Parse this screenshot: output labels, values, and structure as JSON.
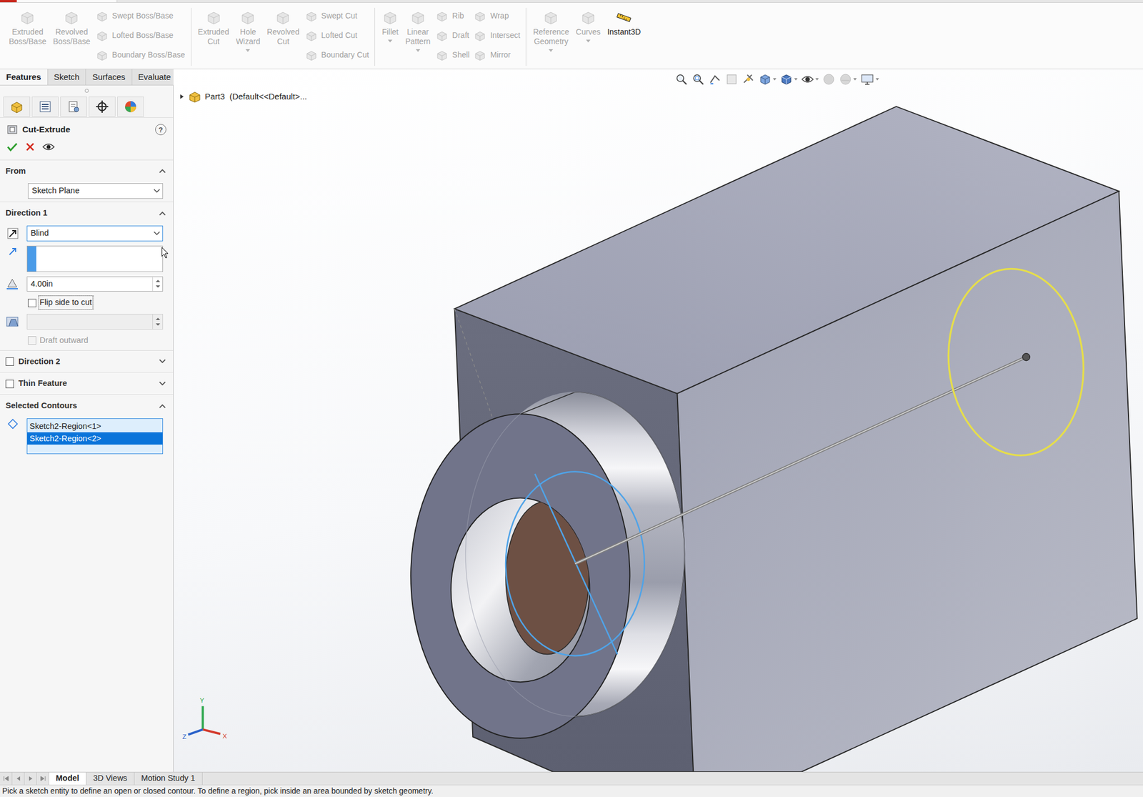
{
  "ribbon": {
    "groups": [
      {
        "items": [
          {
            "kind": "large",
            "label": "Extruded Boss/Base",
            "disabled": true,
            "menu": false
          },
          {
            "kind": "large",
            "label": "Revolved Boss/Base",
            "disabled": true,
            "menu": false
          },
          {
            "kind": "stack",
            "items": [
              {
                "label": "Swept Boss/Base",
                "disabled": true
              },
              {
                "label": "Lofted Boss/Base",
                "disabled": true
              },
              {
                "label": "Boundary Boss/Base",
                "disabled": true
              }
            ]
          }
        ]
      },
      {
        "items": [
          {
            "kind": "large",
            "label": "Extruded Cut",
            "disabled": true,
            "menu": false
          },
          {
            "kind": "large",
            "label": "Hole Wizard",
            "disabled": true,
            "menu": true
          },
          {
            "kind": "large",
            "label": "Revolved Cut",
            "disabled": true,
            "menu": false
          },
          {
            "kind": "stack",
            "items": [
              {
                "label": "Swept Cut",
                "disabled": true
              },
              {
                "label": "Lofted Cut",
                "disabled": true
              },
              {
                "label": "Boundary Cut",
                "disabled": true
              }
            ]
          }
        ]
      },
      {
        "items": [
          {
            "kind": "large",
            "label": "Fillet",
            "disabled": true,
            "menu": true
          },
          {
            "kind": "large",
            "label": "Linear Pattern",
            "disabled": true,
            "menu": true
          },
          {
            "kind": "stack",
            "items": [
              {
                "label": "Rib",
                "disabled": true
              },
              {
                "label": "Draft",
                "disabled": true
              },
              {
                "label": "Shell",
                "disabled": true
              }
            ]
          },
          {
            "kind": "stack",
            "items": [
              {
                "label": "Wrap",
                "disabled": true
              },
              {
                "label": "Intersect",
                "disabled": true
              },
              {
                "label": "Mirror",
                "disabled": true
              }
            ]
          }
        ]
      },
      {
        "items": [
          {
            "kind": "large",
            "label": "Reference Geometry",
            "disabled": true,
            "menu": true
          },
          {
            "kind": "large",
            "label": "Curves",
            "disabled": true,
            "menu": true
          },
          {
            "kind": "large",
            "label": "Instant3D",
            "disabled": false,
            "menu": false
          }
        ]
      }
    ]
  },
  "tabs": [
    {
      "label": "Features",
      "selected": true
    },
    {
      "label": "Sketch",
      "selected": false
    },
    {
      "label": "Surfaces",
      "selected": false
    },
    {
      "label": "Evaluate",
      "selected": false
    }
  ],
  "property_manager": {
    "title": "Cut-Extrude",
    "help": "?",
    "from": {
      "title": "From",
      "expanded": true,
      "value": "Sketch Plane"
    },
    "direction1": {
      "title": "Direction 1",
      "expanded": true,
      "end_condition": "Blind",
      "selection": "",
      "depth": "4.00in",
      "flip_label": "Flip side to cut",
      "flip_checked": false,
      "flip_focused": true,
      "draft_angle": "",
      "draft_enabled": false,
      "draft_outward_label": "Draft outward",
      "draft_outward_checked": false
    },
    "direction2": {
      "title": "Direction 2",
      "checked": false,
      "expanded": false
    },
    "thin_feature": {
      "title": "Thin Feature",
      "checked": false,
      "expanded": false
    },
    "selected_contours": {
      "title": "Selected Contours",
      "expanded": true,
      "items": [
        {
          "label": "Sketch2-Region<1>",
          "selected": false
        },
        {
          "label": "Sketch2-Region<2>",
          "selected": true
        }
      ]
    }
  },
  "tree": {
    "label": "Part3  (Default<<Default>...",
    "expanded": false
  },
  "triad": {
    "y": "Y",
    "z": "Z",
    "x": "X"
  },
  "bottom_tabs": [
    {
      "label": "Model",
      "selected": true
    },
    {
      "label": "3D Views",
      "selected": false
    },
    {
      "label": "Motion Study 1",
      "selected": false
    }
  ],
  "status_bar": "Pick a sketch entity to define an open or closed contour. To define a region, pick inside an area bounded by sketch geometry."
}
